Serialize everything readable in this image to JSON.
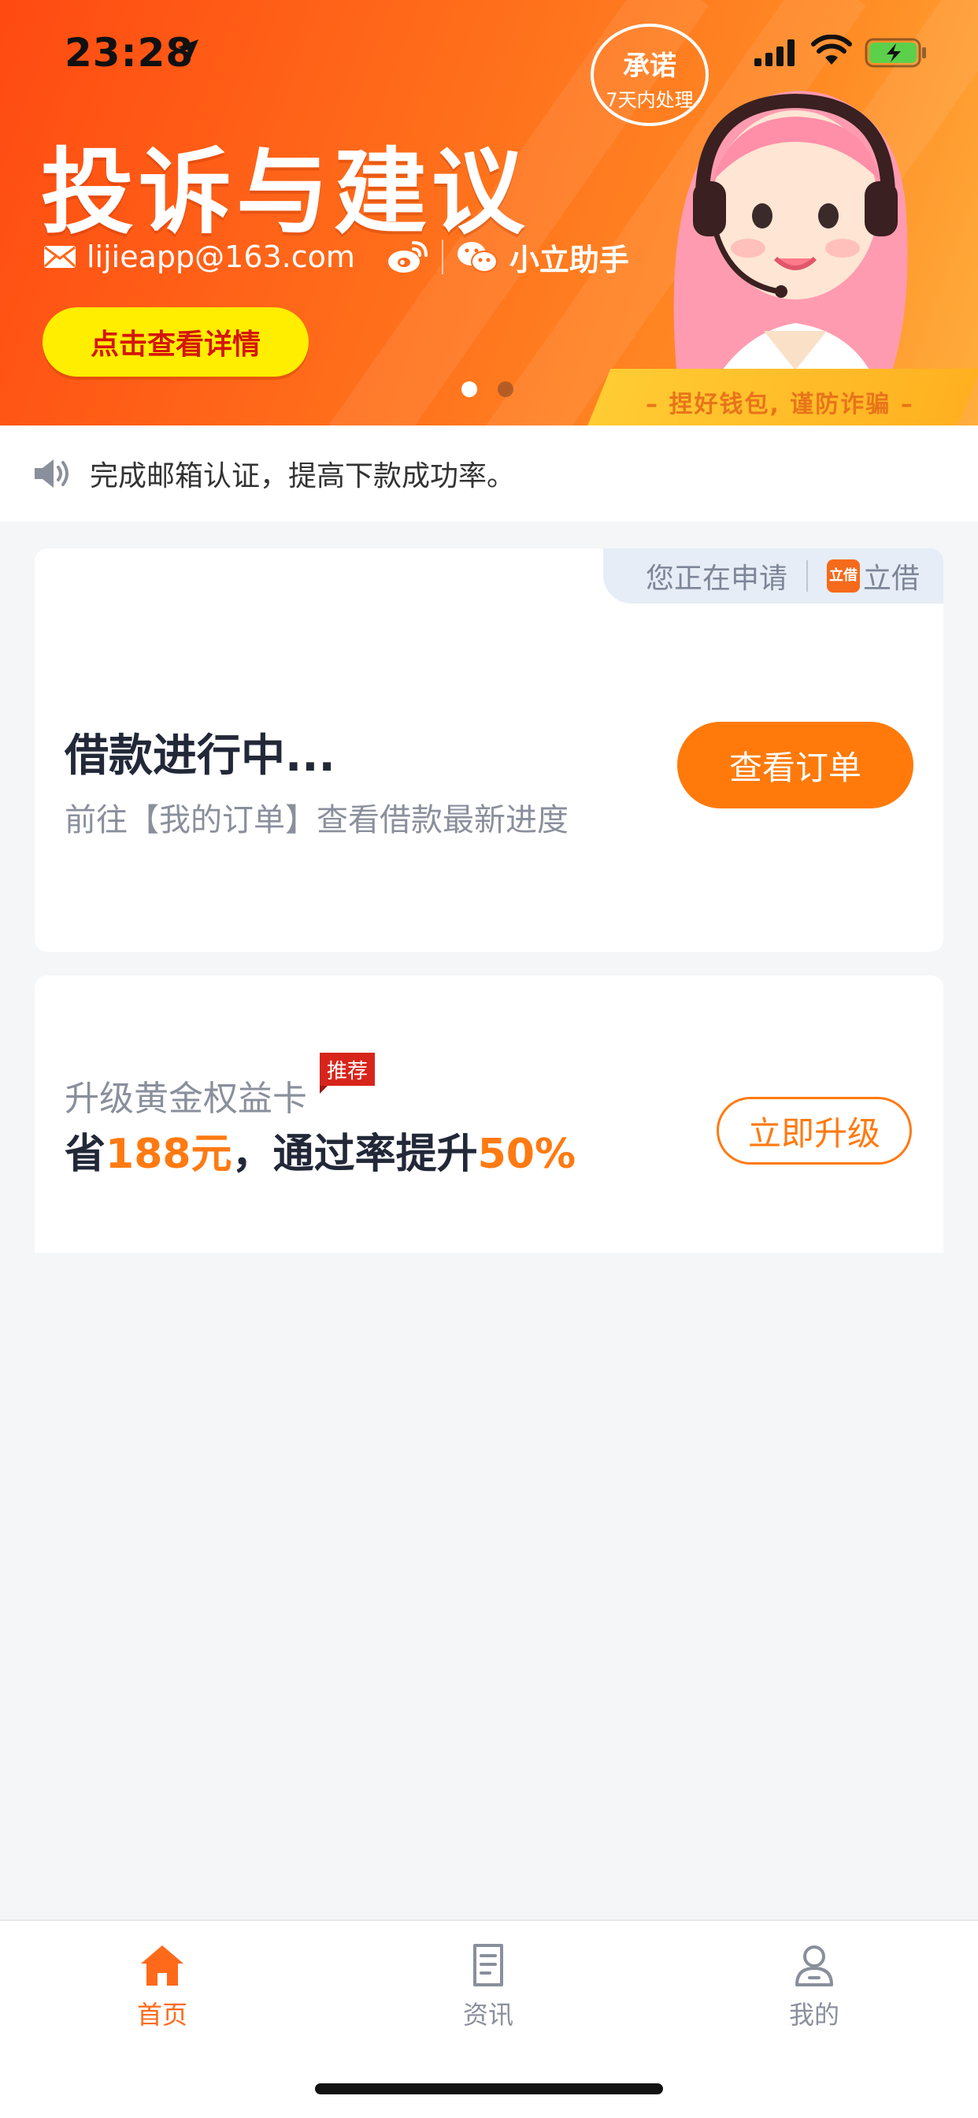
{
  "status_bar": {
    "time": "23:28"
  },
  "banner": {
    "title": "投诉与建议",
    "email": "lijieapp@163.com",
    "assistant": "小立助手",
    "detail_button": "点击查看详情",
    "promise_line1": "承诺",
    "promise_line2": "7天内处理",
    "warning": "– 捏好钱包, 谨防诈骗 –",
    "carousel_total": 2,
    "carousel_active": 1
  },
  "notice": {
    "text": "完成邮箱认证，提高下款成功率。"
  },
  "loan_card": {
    "applying_label": "您正在申请",
    "app_logo_text": "立借",
    "app_name": "立借",
    "title": "借款进行中...",
    "subtitle": "前往【我的订单】查看借款最新进度",
    "button": "查看订单"
  },
  "upgrade_card": {
    "label": "升级黄金权益卡",
    "badge": "推荐",
    "main_prefix": "省",
    "main_amount": "188元",
    "main_middle": "，通过率提升",
    "main_rate": "50%",
    "button": "立即升级"
  },
  "tabbar": {
    "tabs": [
      {
        "label": "首页",
        "icon": "home-icon",
        "active": true
      },
      {
        "label": "资讯",
        "icon": "news-icon",
        "active": false
      },
      {
        "label": "我的",
        "icon": "profile-icon",
        "active": false
      }
    ]
  },
  "colors": {
    "accent": "#ff7a0a",
    "banner_start": "#ff4a12",
    "banner_end": "#ffae3d",
    "detail_button": "#ffee00",
    "badge": "#d8251b"
  }
}
